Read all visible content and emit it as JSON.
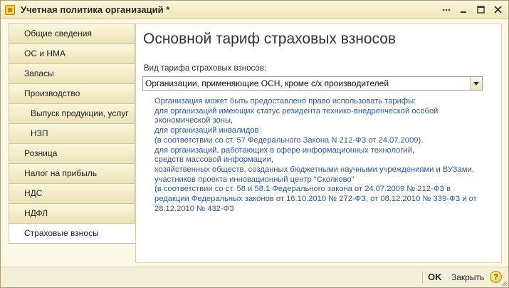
{
  "window": {
    "title": "Учетная политика организаций *"
  },
  "nav": {
    "items": [
      {
        "label": "Общие сведения"
      },
      {
        "label": "ОС и НМА"
      },
      {
        "label": "Запасы"
      },
      {
        "label": "Производство"
      },
      {
        "label": "Выпуск продукции, услуг"
      },
      {
        "label": "НЗП"
      },
      {
        "label": "Розница"
      },
      {
        "label": "Налог на прибыль"
      },
      {
        "label": "НДС"
      },
      {
        "label": "НДФЛ"
      },
      {
        "label": "Страховые взносы"
      }
    ],
    "active": "Страховые взносы"
  },
  "main": {
    "heading": "Основной тариф страховых взносов",
    "tariff_label": "Вид тарифа страховых взносов:",
    "tariff_value": "Организации, применяющие ОСН, кроме с/х производителей",
    "info_lines": [
      "Организация может быть предоставлено право использовать тарифы:",
      "для организаций имеющих статус резидента техникo-внедренческой особой",
      "экономической зоны,",
      "для организаций инвалидов",
      "(в соответствии со ст. 57 Федерального Закона  N 212-ФЗ от 24.07.2009).",
      "для организаций, работающих в сфере информационных технологий,",
      "средств массовой информации,",
      "хозяйственных обществ, созданных бюджетными научными учреждениями и ВУЗами,",
      "участников проекта инновационный центр \"Сколково\"",
      "(в соответствии со ст. 58 и 58.1 Федерального закона от 24.07.2009 № 212-ФЗ в",
      "редакции Федеральных законов от 16.10.2010 № 272-ФЗ, от 08.12.2010 № 339-ФЗ и от",
      "28.12.2010 № 432-ФЗ"
    ]
  },
  "footer": {
    "ok_label": "OK",
    "close_label": "Закрыть",
    "help_label": "?"
  },
  "colors": {
    "info_text": "#2c5aa6",
    "title_bar": "#efe6bb"
  }
}
